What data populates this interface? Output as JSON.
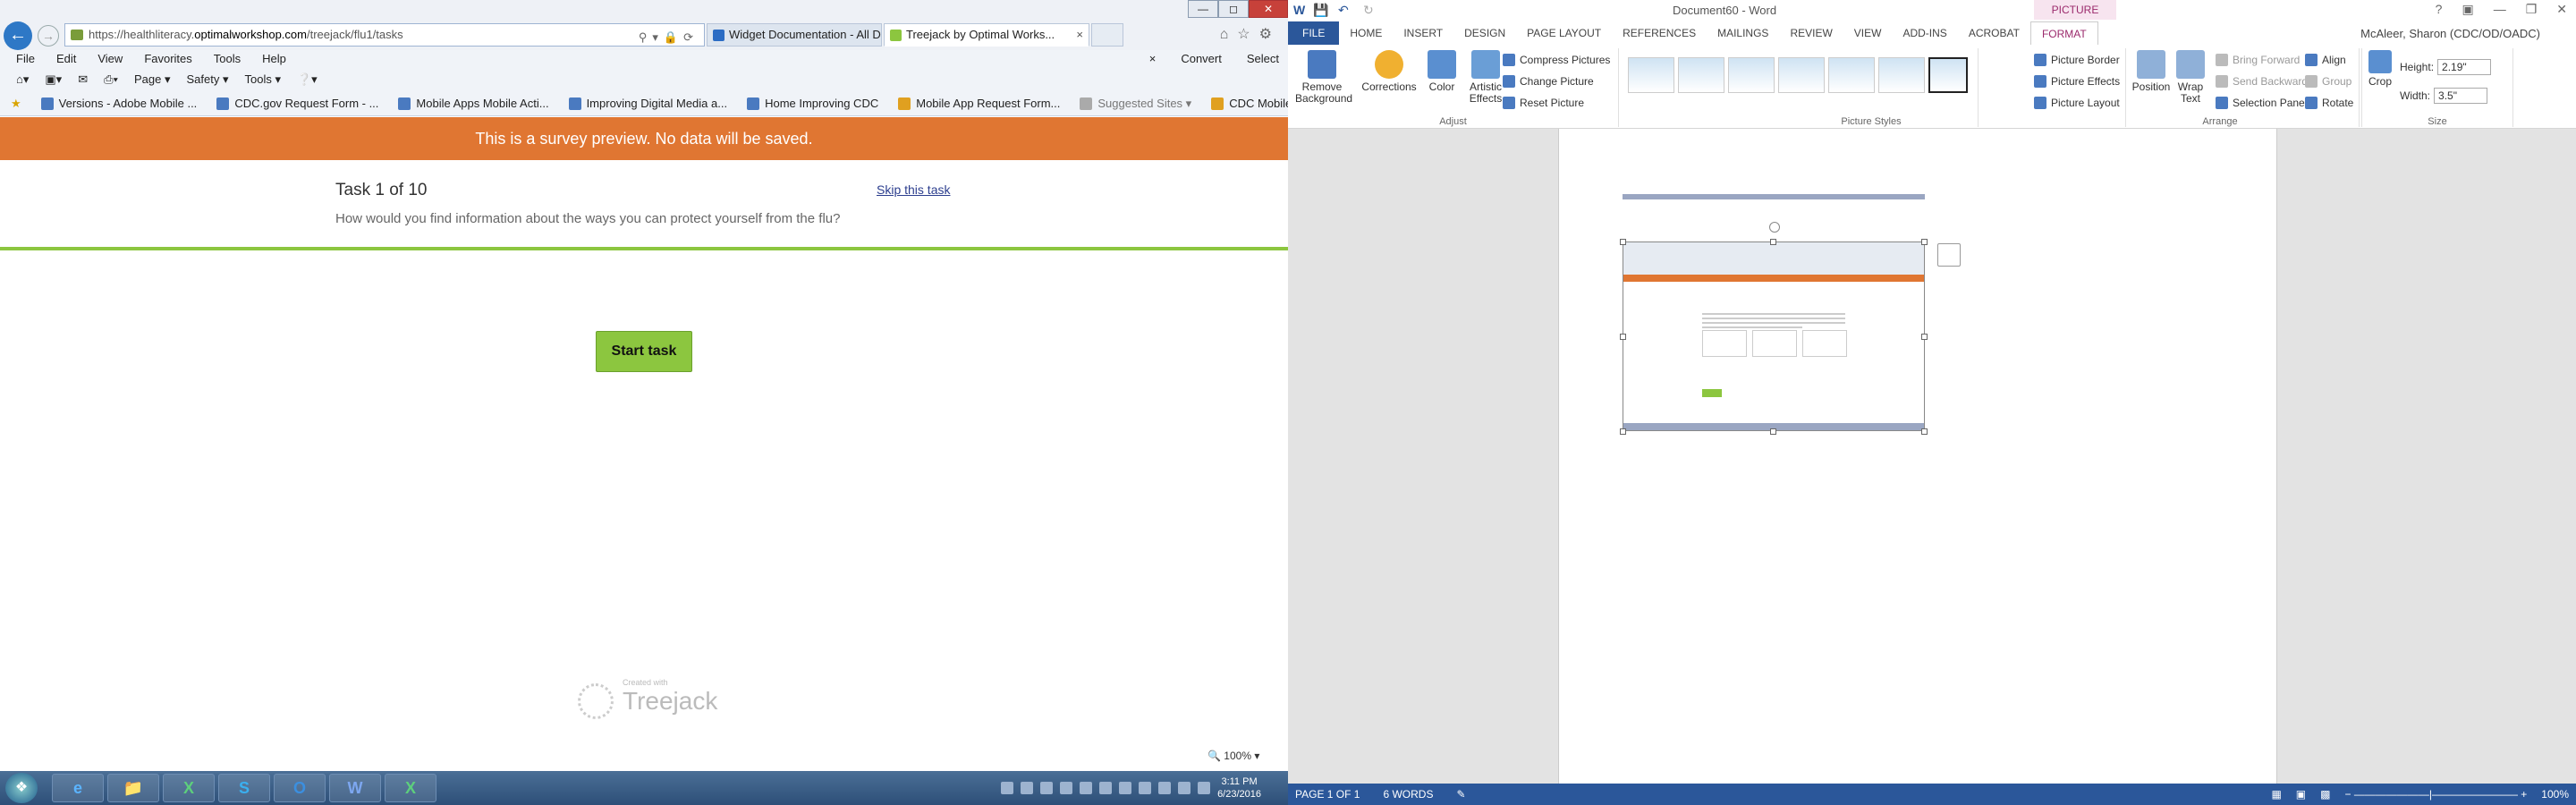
{
  "ie": {
    "address": {
      "prefix": "https://healthliteracy.",
      "domain": "optimalworkshop.com",
      "path": "/treejack/flu1/tasks"
    },
    "tabs": [
      {
        "label": "Widget Documentation - All D...",
        "active": false
      },
      {
        "label": "Treejack by Optimal Works...",
        "active": true
      }
    ],
    "menu": [
      "File",
      "Edit",
      "View",
      "Favorites",
      "Tools",
      "Help"
    ],
    "commands": [
      "Page ▾",
      "Safety ▾",
      "Tools ▾"
    ],
    "right_commands": [
      "Convert",
      "Select"
    ],
    "favorites": [
      "Versions - Adobe Mobile ...",
      "CDC.gov Request Form - ...",
      "Mobile Apps  Mobile Acti...",
      "Improving Digital Media a...",
      "Home  Improving CDC",
      "Mobile App Request Form...",
      "Suggested Sites ▾",
      "CDC Mobile Applications ..."
    ],
    "zoom": "100%"
  },
  "survey": {
    "banner": "This is a survey preview. No data will be saved.",
    "task_title": "Task 1 of 10",
    "skip": "Skip this task",
    "question": "How would you find information about the ways you can protect yourself from the flu?",
    "start_button": "Start task",
    "credit_small": "Created with",
    "credit_big": "Treejack",
    "accent": "#8cc63f",
    "banner_color": "#e07632"
  },
  "word": {
    "title": "Document60 - Word",
    "context_tab": "PICTURE TOOLS",
    "tabs": [
      "FILE",
      "HOME",
      "INSERT",
      "DESIGN",
      "PAGE LAYOUT",
      "REFERENCES",
      "MAILINGS",
      "REVIEW",
      "VIEW",
      "ADD-INS",
      "ACROBAT",
      "FORMAT"
    ],
    "user": "McAleer, Sharon (CDC/OD/OADC)",
    "ribbon": {
      "remove_bg": "Remove Background",
      "corrections": "Corrections",
      "color": "Color",
      "artistic": "Artistic Effects",
      "compress": "Compress Pictures",
      "change": "Change Picture",
      "reset": "Reset Picture",
      "adjust_label": "Adjust",
      "styles_label": "Picture Styles",
      "border": "Picture Border",
      "effects": "Picture Effects",
      "layout": "Picture Layout",
      "position": "Position",
      "wrap": "Wrap Text",
      "forward": "Bring Forward",
      "backward": "Send Backward",
      "selection": "Selection Pane",
      "align": "Align",
      "group": "Group",
      "rotate": "Rotate",
      "arrange_label": "Arrange",
      "crop": "Crop",
      "height_label": "Height:",
      "height_val": "2.19\"",
      "width_label": "Width:",
      "width_val": "3.5\"",
      "size_label": "Size"
    },
    "status": {
      "page": "PAGE 1 OF 1",
      "words": "6 WORDS",
      "zoom": "100%"
    }
  },
  "taskbar": {
    "time": "3:11 PM",
    "date": "6/23/2016",
    "apps": [
      "e",
      "📁",
      "X",
      "S",
      "O",
      "W",
      "X"
    ]
  }
}
